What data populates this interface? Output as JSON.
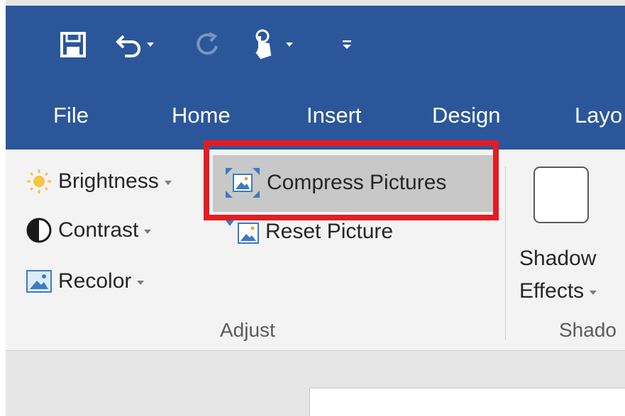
{
  "quick_access": {
    "save": "save-icon",
    "undo": "undo-icon",
    "redo": "redo-icon",
    "touch_mode": "touch-mode-icon",
    "customize": "customize-qat-icon"
  },
  "tabs": [
    "File",
    "Home",
    "Insert",
    "Design",
    "Layo"
  ],
  "adjust": {
    "brightness": "Brightness",
    "contrast": "Contrast",
    "recolor": "Recolor",
    "compress": "Compress Pictures",
    "reset": "Reset Picture",
    "group_label": "Adjust"
  },
  "shadow": {
    "line1": "Shadow",
    "line2": "Effects",
    "group_label": "Shado"
  },
  "colors": {
    "title_blue": "#2b579a",
    "highlight_red": "#e31c23",
    "ribbon_bg": "#f3f3f3"
  }
}
